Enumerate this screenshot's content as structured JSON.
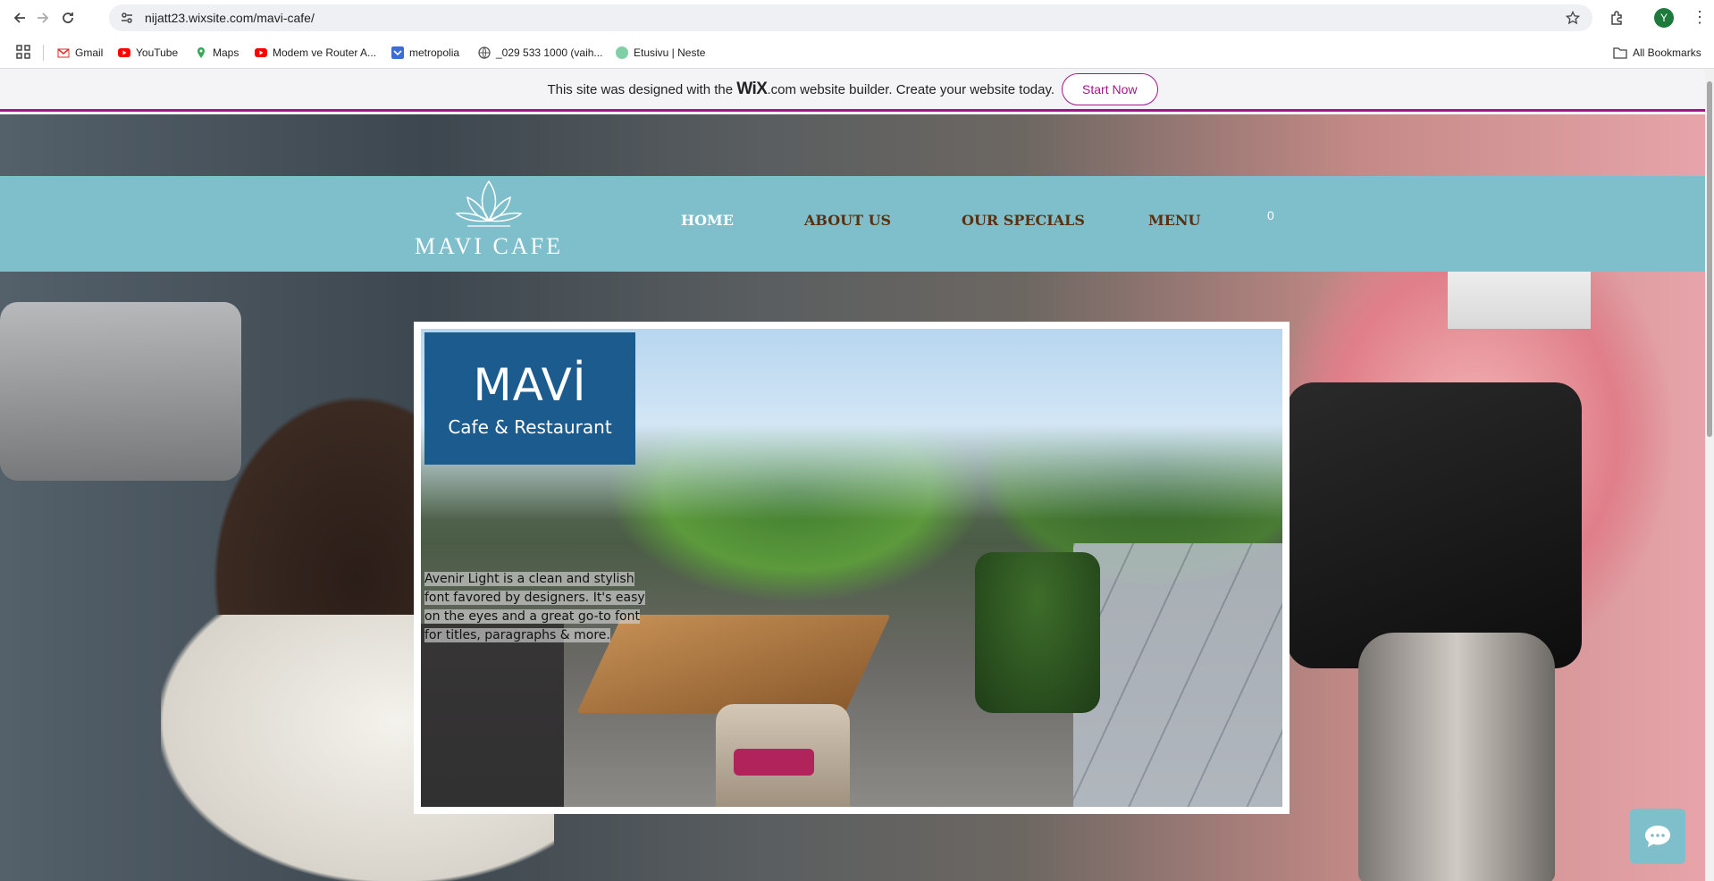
{
  "browser": {
    "url": "nijatt23.wixsite.com/mavi-cafe/",
    "avatar_letter": "Y",
    "bookmarks": [
      {
        "label": "Gmail",
        "icon": "gmail-icon",
        "color": "#d93025"
      },
      {
        "label": "YouTube",
        "icon": "youtube-icon",
        "color": "#ff0000"
      },
      {
        "label": "Maps",
        "icon": "maps-icon",
        "color": "#1a73e8"
      },
      {
        "label": "Modem ve Router A...",
        "icon": "youtube-icon",
        "color": "#ff0000"
      },
      {
        "label": "metropolia",
        "icon": "metropolia-icon",
        "color": "#3b6cd8"
      },
      {
        "label": "_029 533 1000 (vaih...",
        "icon": "globe-icon",
        "color": "#555555"
      },
      {
        "label": "Etusivu | Neste",
        "icon": "neste-icon",
        "color": "#7fd0a4"
      }
    ],
    "all_bookmarks_label": "All Bookmarks"
  },
  "wix_banner": {
    "text_before": "This site was designed with the",
    "logo": "WiX",
    "logo_suffix": ".com",
    "text_after": "website builder. Create your website today.",
    "button_label": "Start Now",
    "accent_color": "#a2168a"
  },
  "site": {
    "logo_text": "MAVI CAFE",
    "menu": [
      {
        "label": "HOME",
        "active": true
      },
      {
        "label": "ABOUT US",
        "active": false
      },
      {
        "label": "OUR SPECIALS",
        "active": false
      },
      {
        "label": "MENU",
        "active": false
      }
    ],
    "cart_count": "0",
    "nav_color": "#7fbfcb",
    "hero": {
      "brand_title": "MAVİ",
      "brand_subtitle": "Cafe & Restaurant",
      "brand_color": "#1c5b8e",
      "placeholder_lines": [
        "Avenir Light is a clean and stylish",
        "font favored by designers. It's easy",
        "on the eyes and a great go-to font",
        "for titles, paragraphs & more."
      ]
    }
  }
}
